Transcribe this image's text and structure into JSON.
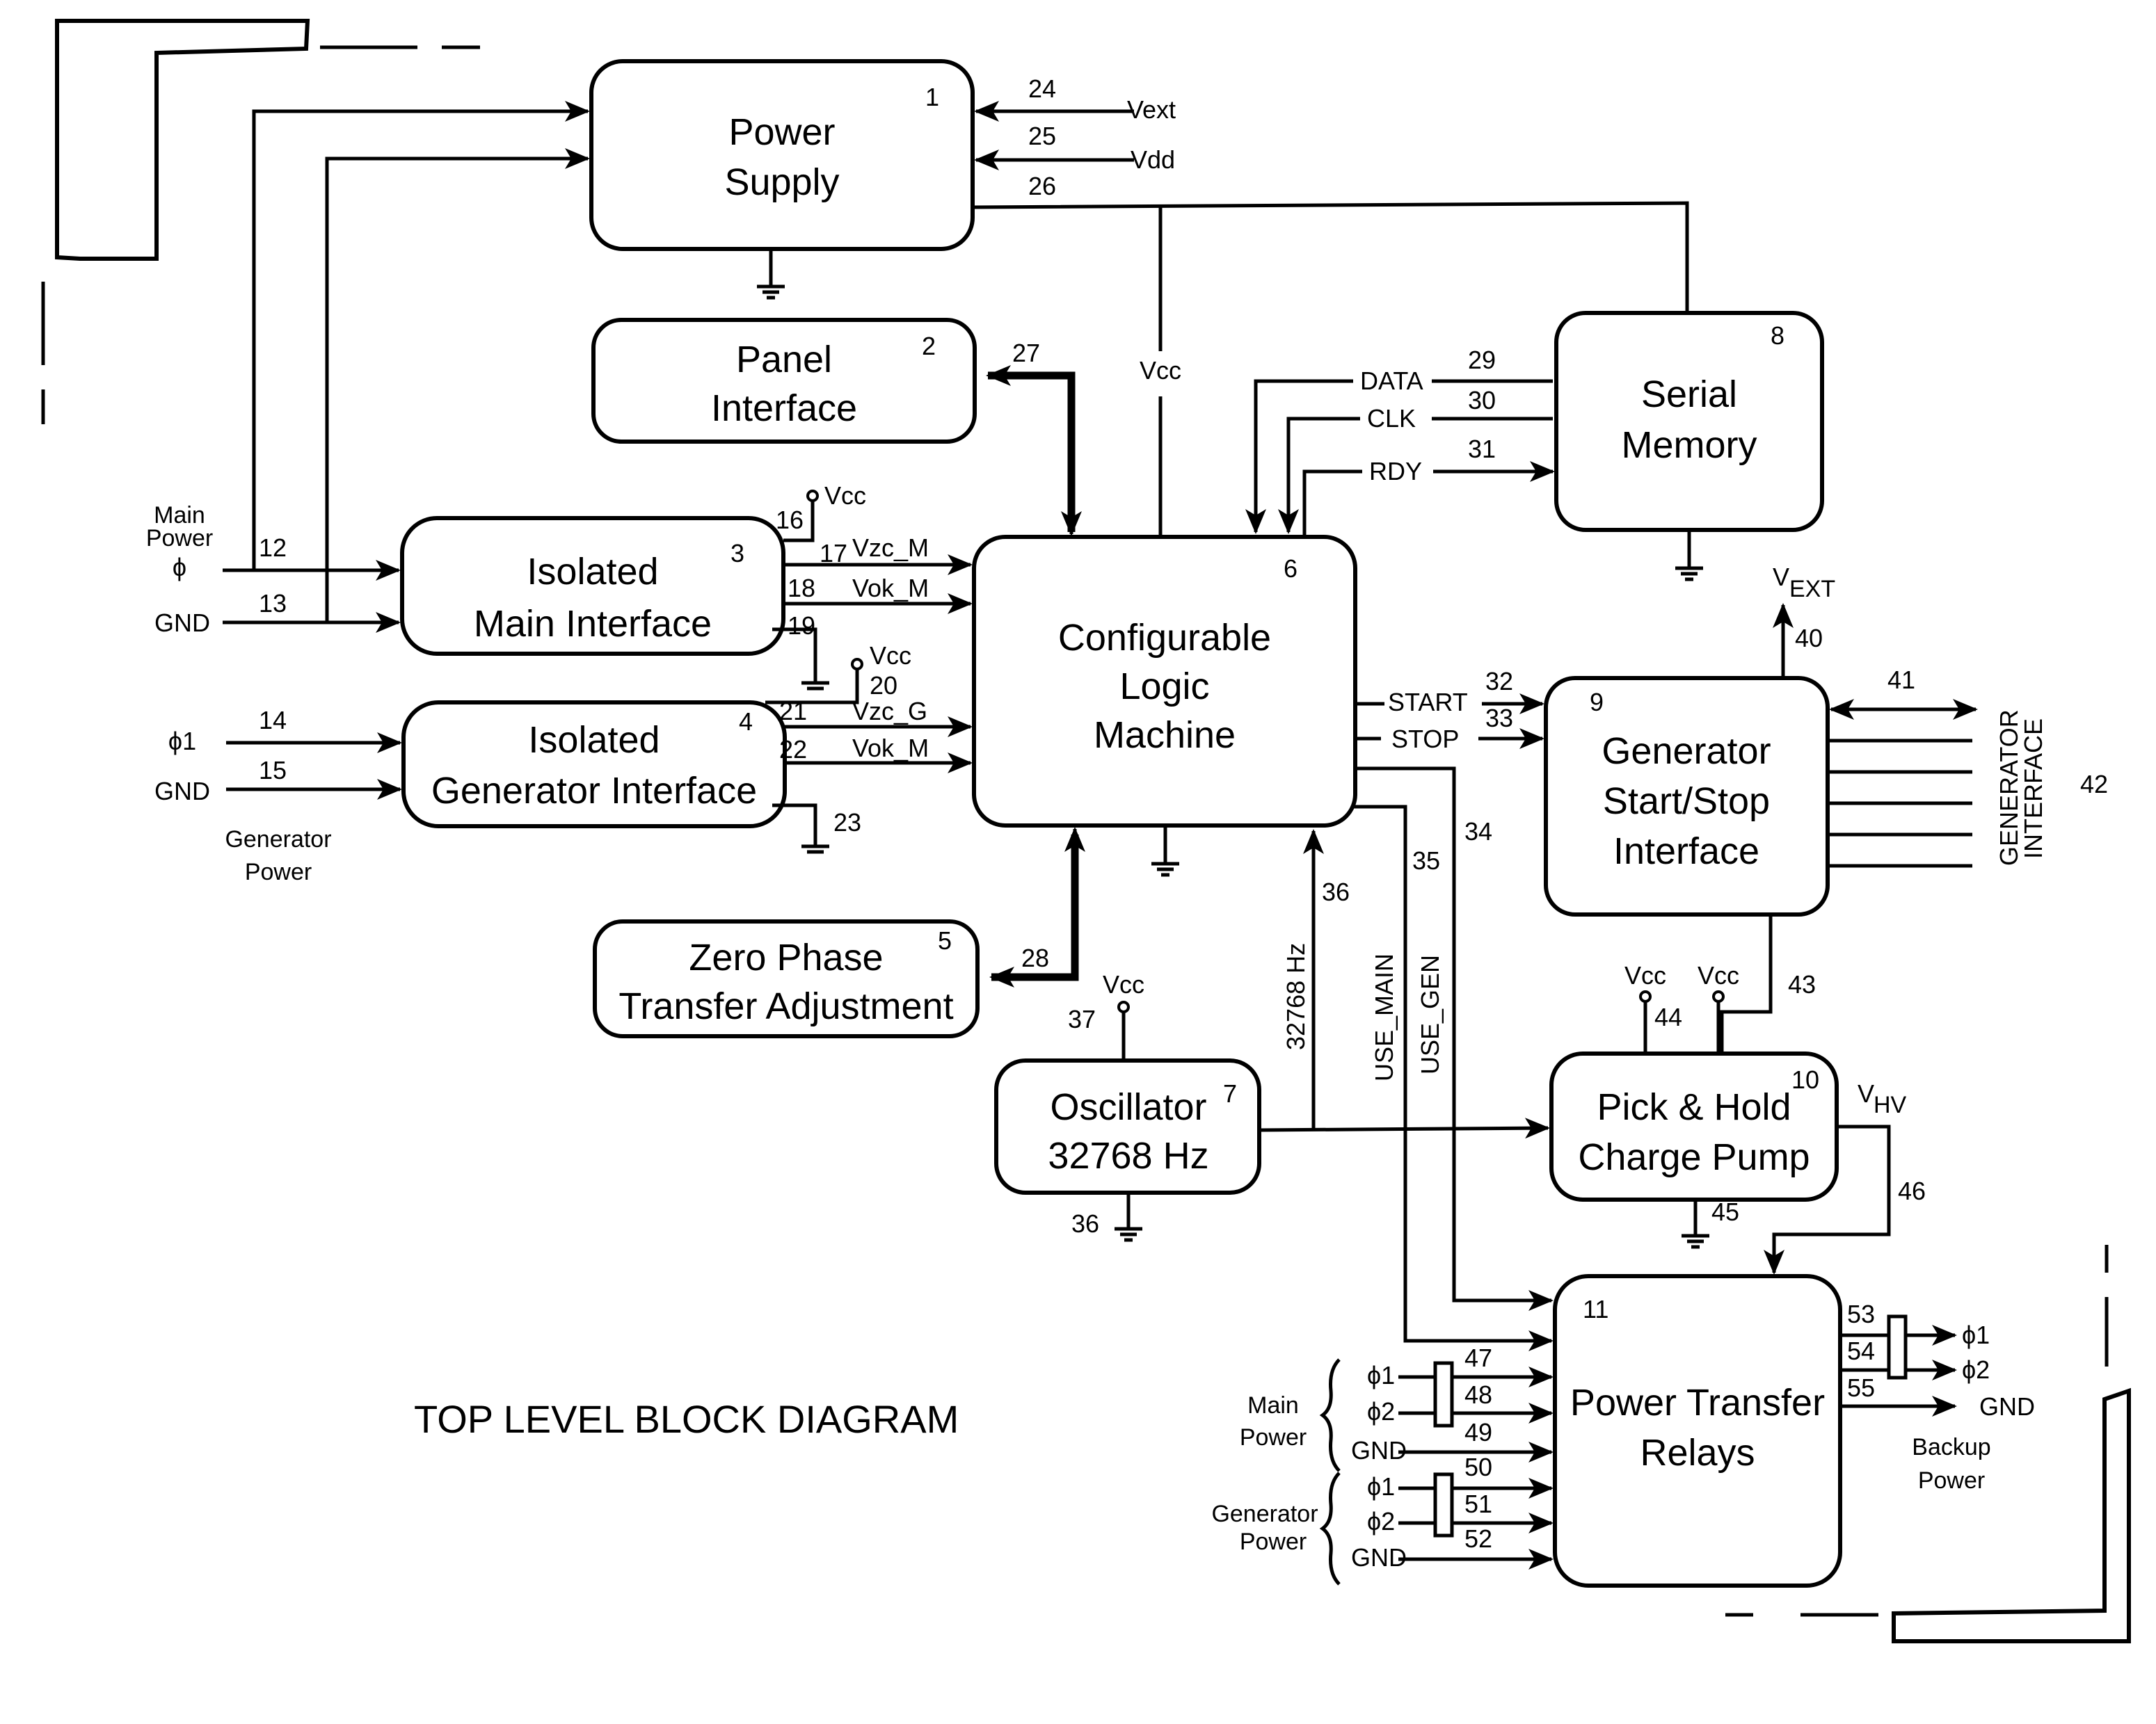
{
  "diagram": {
    "title": "TOP LEVEL BLOCK DIAGRAM",
    "blocks": [
      {
        "id": "1",
        "lines": [
          "Power",
          "Supply"
        ]
      },
      {
        "id": "2",
        "lines": [
          "Panel",
          "Interface"
        ]
      },
      {
        "id": "3",
        "lines": [
          "Isolated",
          "Main Interface"
        ]
      },
      {
        "id": "4",
        "lines": [
          "Isolated",
          "Generator Interface"
        ]
      },
      {
        "id": "5",
        "lines": [
          "Zero Phase",
          "Transfer Adjustment"
        ]
      },
      {
        "id": "6",
        "lines": [
          "Configurable",
          "Logic",
          "Machine"
        ]
      },
      {
        "id": "7",
        "lines": [
          "Oscillator",
          "32768 Hz"
        ]
      },
      {
        "id": "8",
        "lines": [
          "Serial",
          "Memory"
        ]
      },
      {
        "id": "9",
        "lines": [
          "Generator",
          "Start/Stop",
          "Interface"
        ]
      },
      {
        "id": "10",
        "lines": [
          "Pick & Hold",
          "Charge Pump"
        ]
      },
      {
        "id": "11",
        "lines": [
          "Power Transfer",
          "Relays"
        ]
      }
    ],
    "external_labels": {
      "main_power": [
        "Main",
        "Power"
      ],
      "phi": "ϕ",
      "gnd": "GND",
      "phi1": "ϕ1",
      "phi2": "ϕ2",
      "generator_power": [
        "Generator",
        "Power"
      ],
      "backup_power": [
        "Backup",
        "Power"
      ],
      "vext": "Vext",
      "vdd": "Vdd",
      "vcc": "Vcc",
      "v_ext_main": "V",
      "v_ext_sub": "EXT",
      "v_hv_main": "V",
      "v_hv_sub": "HV",
      "generator_interface": [
        "GENERATOR",
        "INTERFACE"
      ]
    },
    "signals": {
      "vzc_m": "Vzc_M",
      "vok_m": "Vok_M",
      "vzc_g": "Vzc_G",
      "vok_m_gen": "Vok_M",
      "data": "DATA",
      "clk": "CLK",
      "rdy": "RDY",
      "start": "START",
      "stop": "STOP",
      "clock_32768": "32768 Hz",
      "use_main": "USE_MAIN",
      "use_gen": "USE_GEN"
    },
    "ref_numbers": {
      "n12": "12",
      "n13": "13",
      "n14": "14",
      "n15": "15",
      "n16": "16",
      "n17": "17",
      "n18": "18",
      "n19": "19",
      "n20": "20",
      "n21": "21",
      "n22": "22",
      "n23": "23",
      "n24": "24",
      "n25": "25",
      "n26": "26",
      "n27": "27",
      "n28": "28",
      "n29": "29",
      "n30": "30",
      "n31": "31",
      "n32": "32",
      "n33": "33",
      "n34": "34",
      "n35": "35",
      "n36": "36",
      "n36b": "36",
      "n37": "37",
      "n40": "40",
      "n41": "41",
      "n42": "42",
      "n43": "43",
      "n44": "44",
      "n45": "45",
      "n46": "46",
      "n47": "47",
      "n48": "48",
      "n49": "49",
      "n50": "50",
      "n51": "51",
      "n52": "52",
      "n53": "53",
      "n54": "54",
      "n55": "55"
    }
  }
}
